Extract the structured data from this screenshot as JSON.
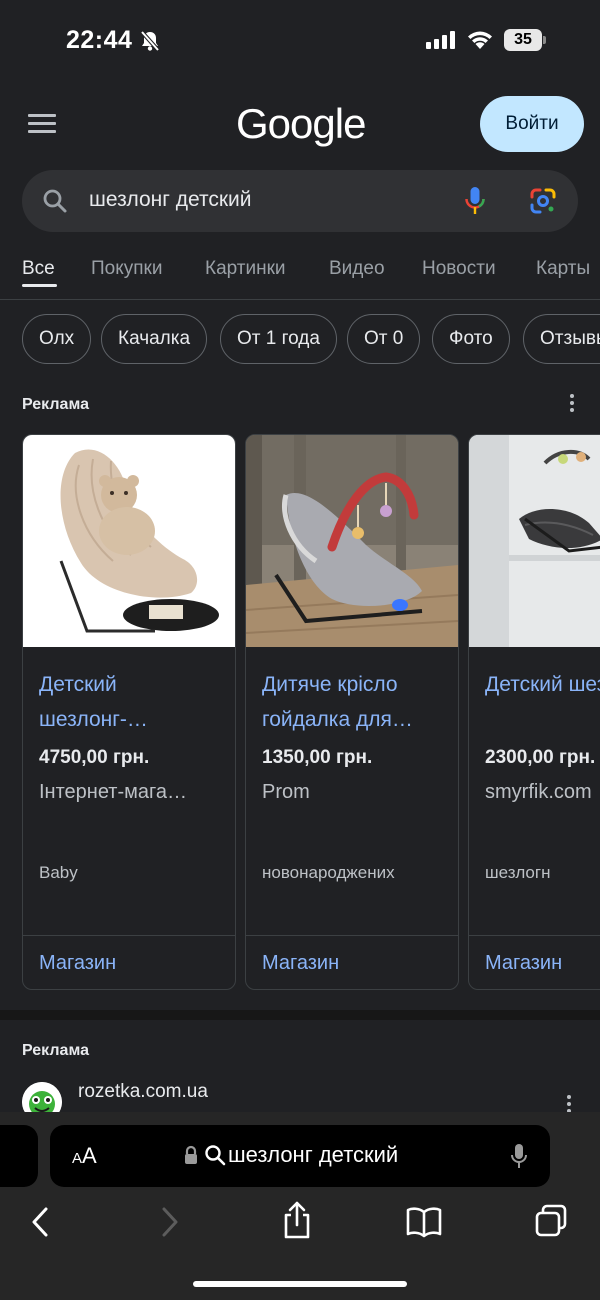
{
  "status_bar": {
    "time": "22:44",
    "battery": "35"
  },
  "header": {
    "logo": "Google",
    "signin_label": "Войти"
  },
  "search": {
    "query": "шезлонг детский"
  },
  "tabs": [
    {
      "label": "Все",
      "active": true
    },
    {
      "label": "Покупки"
    },
    {
      "label": "Картинки"
    },
    {
      "label": "Видео"
    },
    {
      "label": "Новости"
    },
    {
      "label": "Карты"
    }
  ],
  "chips": [
    "Олх",
    "Качалка",
    "От 1 года",
    "От 0",
    "Фото",
    "Отзывы"
  ],
  "ads": {
    "label": "Реклама",
    "products": [
      {
        "title": "Детский шезлонг-…",
        "price": "4750,00 грн.",
        "store": "Інтернет-мага…",
        "tag": "Baby",
        "action": "Магазин"
      },
      {
        "title": "Дитяче крісло гойдалка для…",
        "price": "1350,00 грн.",
        "store": "Prom",
        "tag": "новонароджених",
        "action": "Магазин"
      },
      {
        "title": "Детский шезлогн…",
        "price": "2300,00 грн.",
        "store": "smyrfik.com",
        "tag": "шезлогн",
        "action": "Магазин"
      }
    ]
  },
  "ad2": {
    "label": "Реклама",
    "domain": "rozetka.com.ua"
  },
  "safari": {
    "aa_small": "A",
    "aa_large": "A",
    "address": "шезлонг детский"
  },
  "colors": {
    "background": "#202124",
    "link": "#8ab4f8",
    "signin_bg": "#c2e7ff"
  }
}
